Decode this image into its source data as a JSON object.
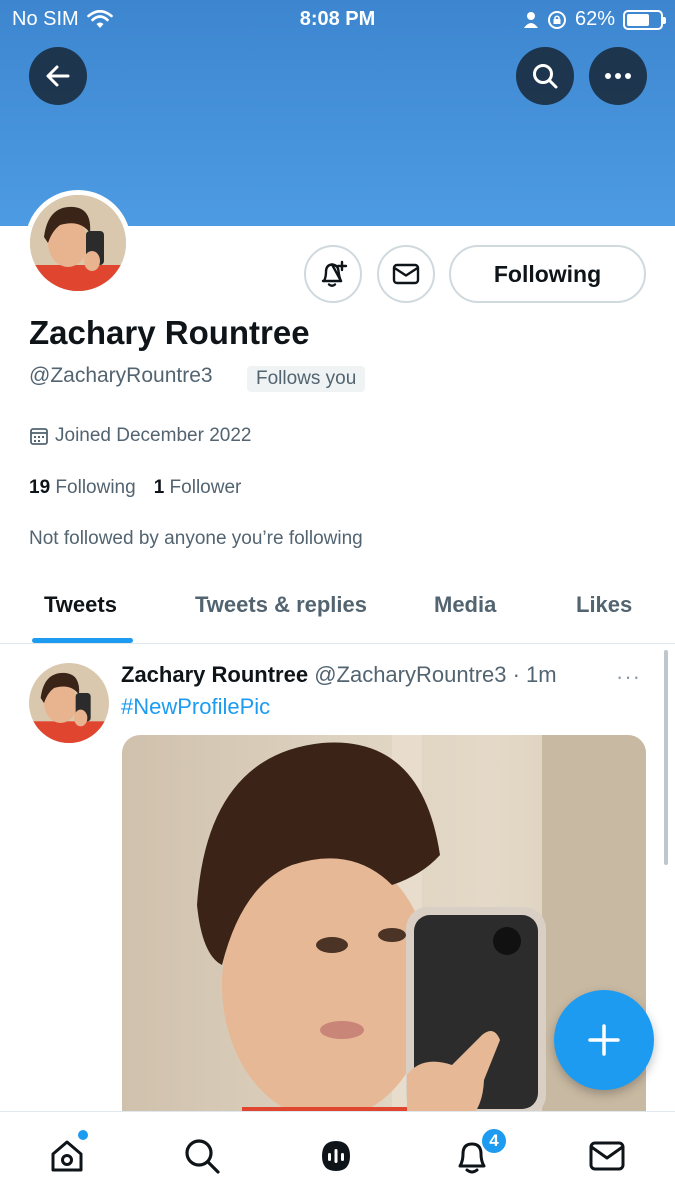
{
  "status_bar": {
    "carrier": "No SIM",
    "time": "8:08 PM",
    "battery": "62%",
    "icons": [
      "wifi-icon",
      "person-icon",
      "lock-rotation-icon",
      "battery-icon"
    ]
  },
  "profile": {
    "name": "Zachary Rountree",
    "handle": "@ZacharyRountre3",
    "follows_you": "Follows you",
    "joined": "Joined December 2022",
    "following_count": "19",
    "following_label": "Following",
    "followers_count": "1",
    "followers_label": "Follower",
    "not_followed": "Not followed by anyone you’re following",
    "following_button": "Following"
  },
  "tabs": [
    {
      "label": "Tweets",
      "active": true
    },
    {
      "label": "Tweets & replies",
      "active": false
    },
    {
      "label": "Media",
      "active": false
    },
    {
      "label": "Likes",
      "active": false
    }
  ],
  "tweet": {
    "name": "Zachary Rountree",
    "meta": "@ZacharyRountre3 · 1m",
    "more": "···",
    "text": "#NewProfilePic"
  },
  "bottom_nav": {
    "notifications_badge": "4",
    "items": [
      "home-icon",
      "search-icon",
      "spaces-icon",
      "notifications-icon",
      "messages-icon"
    ]
  },
  "colors": {
    "accent": "#1d9bf0",
    "banner": "#4a95dd",
    "text_primary": "#0f1419",
    "text_secondary": "#536471"
  }
}
